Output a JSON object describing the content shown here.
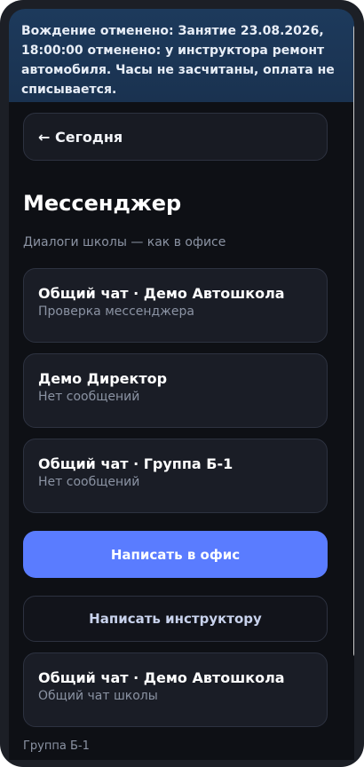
{
  "banner": {
    "text": "Вождение отменено: Занятие 23.08.2026, 18:00:00 отменено: у инструктора ремонт автомобиля. Часы не засчитаны, оплата не списывается."
  },
  "nav": {
    "back_label": "← Сегодня"
  },
  "page": {
    "title": "Мессенджер",
    "subtitle": "Диалоги школы — как в офисе"
  },
  "dialogs": [
    {
      "title": "Общий чат · Демо Автошкола",
      "subtitle": "Проверка мессенджера"
    },
    {
      "title": "Демо Директор",
      "subtitle": "Нет сообщений"
    },
    {
      "title": "Общий чат · Группа Б-1",
      "subtitle": "Нет сообщений"
    }
  ],
  "actions": {
    "write_office": "Написать в офис",
    "write_instructor": "Написать инструктору"
  },
  "extra_chat": {
    "title": "Общий чат · Демо Автошкола",
    "subtitle": "Общий чат школы"
  },
  "section": {
    "label": "Группа Б-1"
  },
  "colors": {
    "accent": "#5a7cff",
    "banner_bg": "#1d3a5c",
    "background": "#0e1015",
    "card_bg": "#1a1d26"
  }
}
